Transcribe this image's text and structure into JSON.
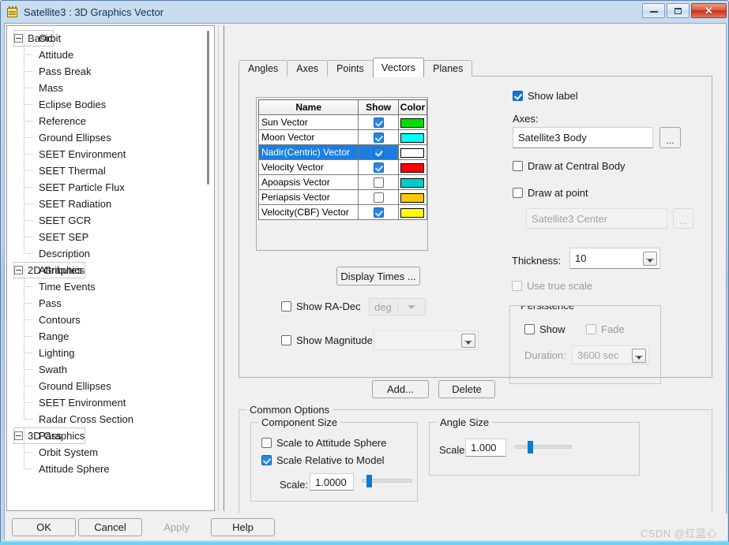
{
  "window": {
    "title": "Satellite3 : 3D Graphics Vector",
    "icon": "properties-sheet-icon",
    "minimize_label": "–",
    "maximize_label": "□",
    "close_label": "✕"
  },
  "tree": {
    "groups": [
      {
        "label": "Basic",
        "expanded": true,
        "items": [
          "Orbit",
          "Attitude",
          "Pass Break",
          "Mass",
          "Eclipse Bodies",
          "Reference",
          "Ground Ellipses",
          "SEET Environment",
          "SEET Thermal",
          "SEET Particle Flux",
          "SEET Radiation",
          "SEET GCR",
          "SEET SEP",
          "Description"
        ]
      },
      {
        "label": "2D Graphics",
        "expanded": true,
        "items": [
          "Attributes",
          "Time Events",
          "Pass",
          "Contours",
          "Range",
          "Lighting",
          "Swath",
          "Ground Ellipses",
          "SEET Environment",
          "Radar Cross Section"
        ]
      },
      {
        "label": "3D Graphics",
        "expanded": true,
        "items": [
          "Pass",
          "Orbit System",
          "Attitude Sphere"
        ]
      }
    ]
  },
  "tabs": [
    {
      "label": "Angles",
      "active": false
    },
    {
      "label": "Axes",
      "active": false
    },
    {
      "label": "Points",
      "active": false
    },
    {
      "label": "Vectors",
      "active": true
    },
    {
      "label": "Planes",
      "active": false
    }
  ],
  "vector_table": {
    "columns": [
      "Name",
      "Show",
      "Color"
    ],
    "rows": [
      {
        "name": "Sun Vector",
        "show": true,
        "color": "#00e000",
        "selected": false
      },
      {
        "name": "Moon Vector",
        "show": true,
        "color": "#00ffff",
        "selected": false
      },
      {
        "name": "Nadir(Centric) Vector",
        "show": true,
        "color": "#ffffff",
        "selected": true
      },
      {
        "name": "Velocity Vector",
        "show": true,
        "color": "#ff0000",
        "selected": false
      },
      {
        "name": "Apoapsis Vector",
        "show": false,
        "color": "#00cccc",
        "selected": false
      },
      {
        "name": "Periapsis Vector",
        "show": false,
        "color": "#ffc800",
        "selected": false
      },
      {
        "name": "Velocity(CBF) Vector",
        "show": true,
        "color": "#ffff00",
        "selected": false
      }
    ]
  },
  "middle": {
    "display_times_label": "Display Times ...",
    "show_radec": {
      "label": "Show RA-Dec",
      "checked": false
    },
    "radec_units": {
      "value": "deg",
      "disabled": true
    },
    "show_magnitude": {
      "label": "Show Magnitude",
      "checked": false
    },
    "magnitude_value": ""
  },
  "right": {
    "show_label": {
      "label": "Show label",
      "checked": true
    },
    "axes_caption": "Axes:",
    "axes_value": "Satellite3 Body",
    "axes_browse_label": "...",
    "draw_at_central_body": {
      "label": "Draw at Central Body",
      "checked": false
    },
    "draw_at_point": {
      "label": "Draw at point",
      "checked": false
    },
    "draw_point_value": "Satellite3 Center",
    "draw_point_browse_label": "...",
    "thickness_caption": "Thickness:",
    "thickness_value": "10",
    "use_true_scale": {
      "label": "Use true scale",
      "checked": false,
      "disabled": true
    },
    "persistence": {
      "title": "Persistence",
      "show": {
        "label": "Show",
        "checked": false
      },
      "fade": {
        "label": "Fade",
        "checked": false,
        "disabled": true
      },
      "duration_caption": "Duration:",
      "duration_value": "3600 sec"
    }
  },
  "actions": {
    "add_label": "Add...",
    "delete_label": "Delete"
  },
  "common_options": {
    "title": "Common Options",
    "component_size": {
      "title": "Component Size",
      "scale_to_attitude_sphere": {
        "label": "Scale to Attitude Sphere",
        "checked": false
      },
      "scale_relative_to_model": {
        "label": "Scale Relative to Model",
        "checked": true
      },
      "scale_caption": "Scale:",
      "scale_value": "1.0000",
      "slider_percent": 9
    },
    "angle_size": {
      "title": "Angle Size",
      "scale_caption": "Scale:",
      "scale_value": "1.000",
      "slider_percent": 22
    }
  },
  "footer": {
    "ok_label": "OK",
    "cancel_label": "Cancel",
    "apply_label": "Apply",
    "apply_disabled": true,
    "help_label": "Help"
  },
  "watermark": "CSDN @红蓝心"
}
